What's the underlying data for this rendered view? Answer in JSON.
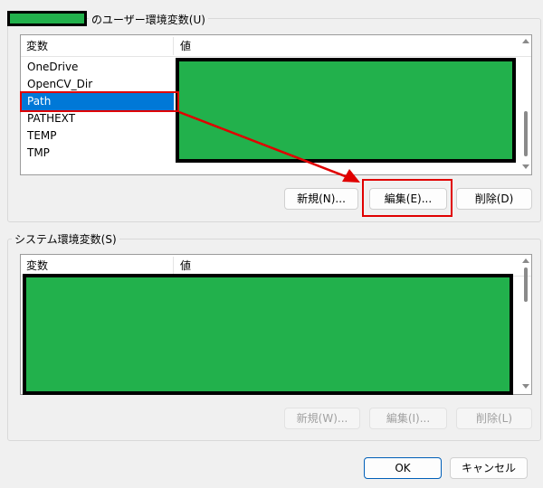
{
  "user_vars": {
    "title_suffix": "のユーザー環境変数(U)",
    "col_variable": "変数",
    "col_value": "値",
    "rows": [
      {
        "name": "OneDrive",
        "selected": false
      },
      {
        "name": "OpenCV_Dir",
        "selected": false
      },
      {
        "name": "Path",
        "selected": true
      },
      {
        "name": "PATHEXT",
        "selected": false
      },
      {
        "name": "TEMP",
        "selected": false
      },
      {
        "name": "TMP",
        "selected": false
      }
    ],
    "buttons": {
      "new": "新規(N)...",
      "edit": "編集(E)...",
      "delete": "削除(D)"
    }
  },
  "system_vars": {
    "title": "システム環境変数(S)",
    "col_variable": "変数",
    "col_value": "値",
    "buttons": {
      "new": "新規(W)...",
      "edit": "編集(I)...",
      "delete": "削除(L)"
    }
  },
  "footer": {
    "ok": "OK",
    "cancel": "キャンセル"
  },
  "colors": {
    "redaction": "#22b14c",
    "highlight": "#e00000",
    "selection": "#0078d7"
  }
}
